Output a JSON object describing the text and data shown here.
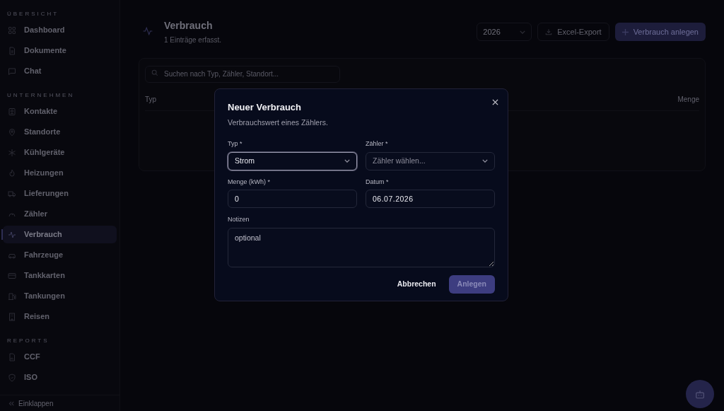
{
  "sidebar": {
    "sections": [
      {
        "heading": "ÜBERSICHT",
        "items": [
          {
            "label": "Dashboard",
            "selected": false
          },
          {
            "label": "Dokumente",
            "selected": false
          },
          {
            "label": "Chat",
            "selected": false
          }
        ]
      },
      {
        "heading": "UNTERNEHMEN",
        "items": [
          {
            "label": "Kontakte",
            "selected": false
          },
          {
            "label": "Standorte",
            "selected": false
          },
          {
            "label": "Kühlgeräte",
            "selected": false
          },
          {
            "label": "Heizungen",
            "selected": false
          },
          {
            "label": "Lieferungen",
            "selected": false
          },
          {
            "label": "Zähler",
            "selected": false
          },
          {
            "label": "Verbrauch",
            "selected": true
          },
          {
            "label": "Fahrzeuge",
            "selected": false
          },
          {
            "label": "Tankkarten",
            "selected": false
          },
          {
            "label": "Tankungen",
            "selected": false
          },
          {
            "label": "Reisen",
            "selected": false
          }
        ]
      },
      {
        "heading": "REPORTS",
        "items": [
          {
            "label": "CCF",
            "selected": false
          },
          {
            "label": "ISO",
            "selected": false
          }
        ]
      }
    ],
    "collapse": "Einklappen"
  },
  "header": {
    "title": "Verbrauch",
    "subtitle": "1 Einträge erfasst.",
    "year": "2026",
    "export_button": "Excel-Export",
    "create_button": "Verbrauch anlegen"
  },
  "table": {
    "search": {
      "placeholder": "Suchen nach Typ, Zähler, Standort..."
    },
    "columns": [
      "Typ",
      "Menge"
    ]
  },
  "dialog": {
    "title": "Neuer Verbrauch",
    "subtitle": "Verbrauchswert eines Zählers.",
    "fields": [
      {
        "kind": "select",
        "label": "Typ *",
        "value": "Strom",
        "focused": true
      },
      {
        "kind": "select",
        "label": "Zähler *",
        "placeholder": "Zähler wählen...",
        "focused": false
      },
      {
        "kind": "input",
        "label": "Menge (kWh) *",
        "value": "0",
        "focused": false
      },
      {
        "kind": "date",
        "label": "Datum *",
        "value": "06.07.2026",
        "focused": false
      },
      {
        "kind": "textarea",
        "label": "Notizen",
        "placeholder": "optional",
        "focused": false
      }
    ],
    "cancel_button": "Abbrechen",
    "submit_button": "Anlegen",
    "submit_disabled": true
  }
}
